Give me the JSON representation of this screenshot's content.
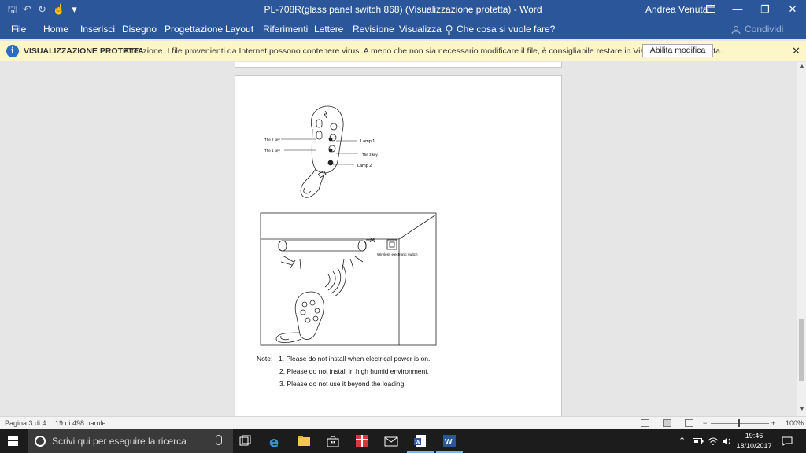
{
  "window": {
    "title": "PL-708R(glass panel switch 868) (Visualizzazione protetta)  -  Word",
    "user": "Andrea Venuta",
    "controls": {
      "minimize": "—",
      "maximize": "❐",
      "close": "✕"
    }
  },
  "quick_access": {
    "save": "🖫",
    "undo": "↶",
    "redo": "↻",
    "touch": "☝",
    "customize": "▾"
  },
  "ribbon": {
    "tabs": [
      "File",
      "Home",
      "Inserisci",
      "Disegno",
      "Progettazione",
      "Layout",
      "Riferimenti",
      "Lettere",
      "Revisione",
      "Visualizza"
    ],
    "tell_me": "Che cosa si vuole fare?",
    "share": "Condividi"
  },
  "protected_view": {
    "title": "VISUALIZZAZIONE PROTETTA",
    "message": "Attenzione. I file provenienti da Internet possono contenere virus. A meno che non sia necessario modificare il file, è consigliabile restare in Visualizzazione protetta.",
    "enable_button": "Abilita modifica",
    "close": "✕"
  },
  "document": {
    "remote_labels": {
      "key2": "The 2 key",
      "key1": "The 1 key",
      "lamp1": "Lamp 1",
      "key3": "The 3 key",
      "lamp2": "Lamp 2"
    },
    "switch_label": "Wireless electronic switch",
    "note_label": "Note:",
    "notes": [
      "1. Please do not install when electrical power is on.",
      "2. Please do not install in high humid environment.",
      "3. Please do not use it beyond the loading"
    ]
  },
  "statusbar": {
    "page": "Pagina 3 di 4",
    "words": "19 di 498 parole",
    "zoom": "100%",
    "zoom_minus": "−",
    "zoom_plus": "+"
  },
  "taskbar": {
    "search_placeholder": "Scrivi qui per eseguire la ricerca",
    "time": "19:46",
    "date": "18/10/2017"
  },
  "colors": {
    "word_blue": "#2b579a",
    "protected_bar": "#fcf6c8",
    "taskbar": "#1c1c1c"
  }
}
